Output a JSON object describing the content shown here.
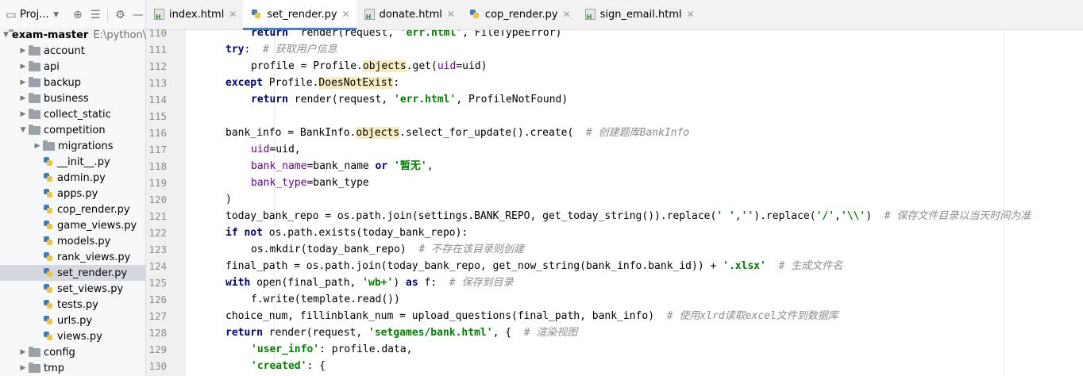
{
  "project_panel": {
    "title": "Proj...",
    "root": {
      "name": "exam-master",
      "path": "E:\\python\\"
    },
    "items": [
      {
        "label": "account",
        "kind": "folder",
        "depth": 1,
        "expanded": false
      },
      {
        "label": "api",
        "kind": "folder",
        "depth": 1,
        "expanded": false
      },
      {
        "label": "backup",
        "kind": "folder",
        "depth": 1,
        "expanded": false
      },
      {
        "label": "business",
        "kind": "folder",
        "depth": 1,
        "expanded": false
      },
      {
        "label": "collect_static",
        "kind": "folder",
        "depth": 1,
        "expanded": false
      },
      {
        "label": "competition",
        "kind": "folder",
        "depth": 1,
        "expanded": true
      },
      {
        "label": "migrations",
        "kind": "folder",
        "depth": 2,
        "expanded": false
      },
      {
        "label": "__init__.py",
        "kind": "py",
        "depth": 2
      },
      {
        "label": "admin.py",
        "kind": "py",
        "depth": 2
      },
      {
        "label": "apps.py",
        "kind": "py",
        "depth": 2
      },
      {
        "label": "cop_render.py",
        "kind": "py",
        "depth": 2
      },
      {
        "label": "game_views.py",
        "kind": "py",
        "depth": 2
      },
      {
        "label": "models.py",
        "kind": "py",
        "depth": 2
      },
      {
        "label": "rank_views.py",
        "kind": "py",
        "depth": 2
      },
      {
        "label": "set_render.py",
        "kind": "py",
        "depth": 2,
        "selected": true
      },
      {
        "label": "set_views.py",
        "kind": "py",
        "depth": 2
      },
      {
        "label": "tests.py",
        "kind": "py",
        "depth": 2
      },
      {
        "label": "urls.py",
        "kind": "py",
        "depth": 2
      },
      {
        "label": "views.py",
        "kind": "py",
        "depth": 2
      },
      {
        "label": "config",
        "kind": "folder",
        "depth": 1,
        "expanded": false
      },
      {
        "label": "tmp",
        "kind": "folder",
        "depth": 1,
        "expanded": false
      }
    ]
  },
  "tabs": [
    {
      "label": "index.html",
      "kind": "html",
      "active": false
    },
    {
      "label": "set_render.py",
      "kind": "py",
      "active": true
    },
    {
      "label": "donate.html",
      "kind": "html",
      "active": false
    },
    {
      "label": "cop_render.py",
      "kind": "py",
      "active": false
    },
    {
      "label": "sign_email.html",
      "kind": "html",
      "active": false
    }
  ],
  "editor": {
    "lines": [
      {
        "n": "110",
        "indent": 2,
        "tokens": [
          [
            "kw",
            "return"
          ],
          [
            "",
            "  render(request, "
          ],
          [
            "str",
            "'err.html'"
          ],
          [
            "",
            ", FileTypeError)"
          ]
        ]
      },
      {
        "n": "111",
        "indent": 1,
        "tokens": [
          [
            "kw",
            "try"
          ],
          [
            "",
            ":  "
          ],
          [
            "cm",
            "# 获取用户信息"
          ]
        ]
      },
      {
        "n": "112",
        "indent": 2,
        "tokens": [
          [
            "",
            "profile = Profile."
          ],
          [
            "hl",
            "objects"
          ],
          [
            "",
            ".get("
          ],
          [
            "param",
            "uid"
          ],
          [
            "",
            "=uid)"
          ]
        ]
      },
      {
        "n": "113",
        "indent": 1,
        "tokens": [
          [
            "kw",
            "except"
          ],
          [
            "",
            " Profile."
          ],
          [
            "hl",
            "DoesNotExist"
          ],
          [
            "",
            ":"
          ]
        ]
      },
      {
        "n": "114",
        "indent": 2,
        "tokens": [
          [
            "kw",
            "return"
          ],
          [
            "",
            " render(request, "
          ],
          [
            "str",
            "'err.html'"
          ],
          [
            "",
            ", ProfileNotFound)"
          ]
        ]
      },
      {
        "n": "115",
        "indent": 0,
        "tokens": []
      },
      {
        "n": "116",
        "indent": 1,
        "tokens": [
          [
            "",
            "bank_info = BankInfo."
          ],
          [
            "hl",
            "objects"
          ],
          [
            "",
            ".select_for_update().create(  "
          ],
          [
            "cm",
            "# 创建题库BankInfo"
          ]
        ]
      },
      {
        "n": "117",
        "indent": 2,
        "tokens": [
          [
            "param",
            "uid"
          ],
          [
            "",
            "=uid,"
          ]
        ]
      },
      {
        "n": "118",
        "indent": 2,
        "tokens": [
          [
            "param",
            "bank_name"
          ],
          [
            "",
            "=bank_name "
          ],
          [
            "kw",
            "or"
          ],
          [
            "",
            " "
          ],
          [
            "str",
            "'暂无'"
          ],
          [
            "",
            ","
          ]
        ]
      },
      {
        "n": "119",
        "indent": 2,
        "tokens": [
          [
            "param",
            "bank_type"
          ],
          [
            "",
            "=bank_type"
          ]
        ]
      },
      {
        "n": "120",
        "indent": 1,
        "tokens": [
          [
            "",
            ")"
          ]
        ]
      },
      {
        "n": "121",
        "indent": 1,
        "tokens": [
          [
            "",
            "today_bank_repo = os.path.join(settings.BANK_REPO, get_today_string()).replace("
          ],
          [
            "str",
            "' '"
          ],
          [
            "",
            ","
          ],
          [
            "str",
            "''"
          ],
          [
            "",
            ").replace("
          ],
          [
            "str",
            "'/'"
          ],
          [
            "",
            ","
          ],
          [
            "str",
            "'\\\\'"
          ],
          [
            "",
            ")  "
          ],
          [
            "cm",
            "# 保存文件目录以当天时间为准"
          ]
        ]
      },
      {
        "n": "122",
        "indent": 1,
        "tokens": [
          [
            "kw",
            "if not"
          ],
          [
            "",
            " os.path.exists(today_bank_repo):"
          ]
        ]
      },
      {
        "n": "123",
        "indent": 2,
        "tokens": [
          [
            "",
            "os.mkdir(today_bank_repo)  "
          ],
          [
            "cm",
            "# 不存在该目录则创建"
          ]
        ]
      },
      {
        "n": "124",
        "indent": 1,
        "tokens": [
          [
            "",
            "final_path = os.path.join(today_bank_repo, get_now_string(bank_info.bank_id)) + "
          ],
          [
            "str",
            "'.xlsx'"
          ],
          [
            "",
            "  "
          ],
          [
            "cm",
            "# 生成文件名"
          ]
        ]
      },
      {
        "n": "125",
        "indent": 1,
        "tokens": [
          [
            "kw",
            "with"
          ],
          [
            "",
            " open(final_path, "
          ],
          [
            "str",
            "'wb+'"
          ],
          [
            "",
            ") "
          ],
          [
            "kw",
            "as"
          ],
          [
            "",
            " f:  "
          ],
          [
            "cm",
            "# 保存到目录"
          ]
        ]
      },
      {
        "n": "126",
        "indent": 2,
        "tokens": [
          [
            "",
            "f.write(template.read())"
          ]
        ]
      },
      {
        "n": "127",
        "indent": 1,
        "tokens": [
          [
            "",
            "choice_num, fillinblank_num = upload_questions(final_path, bank_info)  "
          ],
          [
            "cm",
            "# 使用xlrd读取excel文件到数据库"
          ]
        ]
      },
      {
        "n": "128",
        "indent": 1,
        "tokens": [
          [
            "kw",
            "return"
          ],
          [
            "",
            " render(request, "
          ],
          [
            "str",
            "'setgames/bank.html'"
          ],
          [
            "",
            ", {  "
          ],
          [
            "cm",
            "# 渲染视图"
          ]
        ]
      },
      {
        "n": "129",
        "indent": 2,
        "tokens": [
          [
            "str",
            "'user_info'"
          ],
          [
            "",
            ": profile.data,"
          ]
        ]
      },
      {
        "n": "130",
        "indent": 2,
        "tokens": [
          [
            "str",
            "'created'"
          ],
          [
            "",
            ": {"
          ]
        ]
      }
    ]
  },
  "colors": {
    "keyword": "#000080",
    "string": "#008000",
    "comment": "#8c8c8c",
    "param": "#660099",
    "highlight": "#f7ecc0",
    "active_tab_accent": "#4083c9"
  }
}
